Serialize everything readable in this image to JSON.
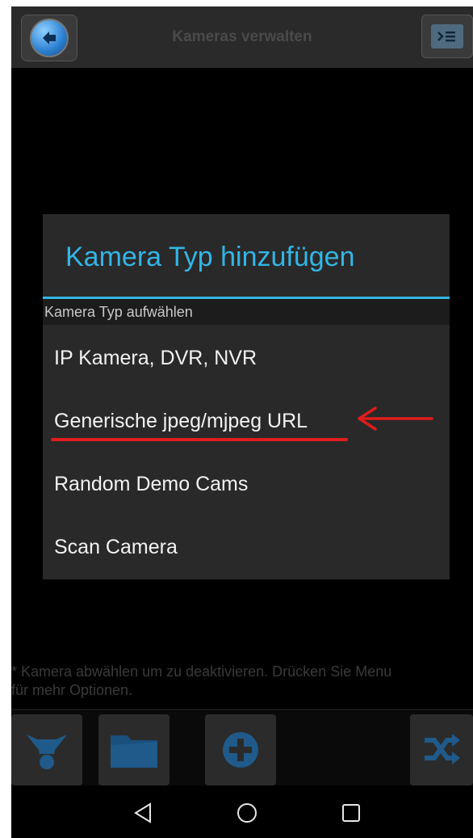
{
  "header": {
    "title": "Kameras verwalten",
    "back_icon": "arrow-left-icon",
    "menu_icon": "menu-list-icon"
  },
  "dialog": {
    "title": "Kamera Typ hinzufügen",
    "subtitle": "Kamera Typ aufwählen",
    "options": [
      "IP Kamera, DVR, NVR",
      "Generische jpeg/mjpeg URL",
      "Random Demo Cams",
      "Scan Camera"
    ],
    "accent_color": "#33b5e5",
    "highlight_color": "#e01c1c"
  },
  "hint": {
    "line1": "* Kamera abwählen um zu deaktivieren. Drücken Sie Menu",
    "line2": "für mehr Optionen."
  },
  "toolbar": {
    "icons": [
      "network-icon",
      "folder-icon",
      "add-icon",
      "shuffle-icon"
    ]
  },
  "navbar": {
    "icons": [
      "nav-back-icon",
      "nav-home-icon",
      "nav-recents-icon"
    ]
  }
}
